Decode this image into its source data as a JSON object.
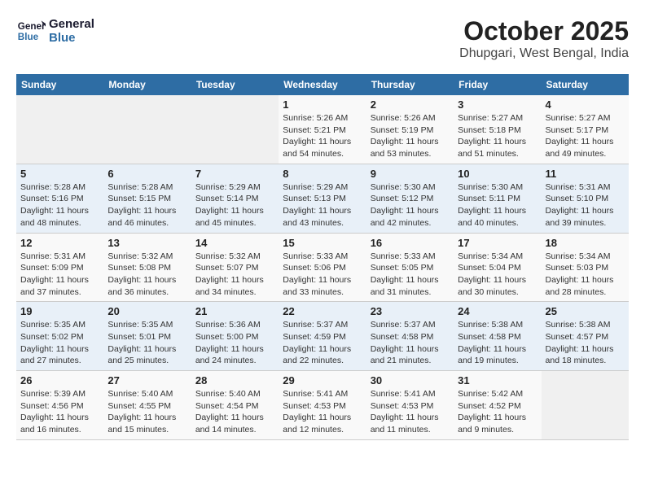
{
  "logo": {
    "line1": "General",
    "line2": "Blue"
  },
  "title": "October 2025",
  "subtitle": "Dhupgari, West Bengal, India",
  "headers": [
    "Sunday",
    "Monday",
    "Tuesday",
    "Wednesday",
    "Thursday",
    "Friday",
    "Saturday"
  ],
  "weeks": [
    [
      null,
      null,
      null,
      {
        "day": "1",
        "sunrise": "Sunrise: 5:26 AM",
        "sunset": "Sunset: 5:21 PM",
        "daylight": "Daylight: 11 hours and 54 minutes."
      },
      {
        "day": "2",
        "sunrise": "Sunrise: 5:26 AM",
        "sunset": "Sunset: 5:19 PM",
        "daylight": "Daylight: 11 hours and 53 minutes."
      },
      {
        "day": "3",
        "sunrise": "Sunrise: 5:27 AM",
        "sunset": "Sunset: 5:18 PM",
        "daylight": "Daylight: 11 hours and 51 minutes."
      },
      {
        "day": "4",
        "sunrise": "Sunrise: 5:27 AM",
        "sunset": "Sunset: 5:17 PM",
        "daylight": "Daylight: 11 hours and 49 minutes."
      }
    ],
    [
      {
        "day": "5",
        "sunrise": "Sunrise: 5:28 AM",
        "sunset": "Sunset: 5:16 PM",
        "daylight": "Daylight: 11 hours and 48 minutes."
      },
      {
        "day": "6",
        "sunrise": "Sunrise: 5:28 AM",
        "sunset": "Sunset: 5:15 PM",
        "daylight": "Daylight: 11 hours and 46 minutes."
      },
      {
        "day": "7",
        "sunrise": "Sunrise: 5:29 AM",
        "sunset": "Sunset: 5:14 PM",
        "daylight": "Daylight: 11 hours and 45 minutes."
      },
      {
        "day": "8",
        "sunrise": "Sunrise: 5:29 AM",
        "sunset": "Sunset: 5:13 PM",
        "daylight": "Daylight: 11 hours and 43 minutes."
      },
      {
        "day": "9",
        "sunrise": "Sunrise: 5:30 AM",
        "sunset": "Sunset: 5:12 PM",
        "daylight": "Daylight: 11 hours and 42 minutes."
      },
      {
        "day": "10",
        "sunrise": "Sunrise: 5:30 AM",
        "sunset": "Sunset: 5:11 PM",
        "daylight": "Daylight: 11 hours and 40 minutes."
      },
      {
        "day": "11",
        "sunrise": "Sunrise: 5:31 AM",
        "sunset": "Sunset: 5:10 PM",
        "daylight": "Daylight: 11 hours and 39 minutes."
      }
    ],
    [
      {
        "day": "12",
        "sunrise": "Sunrise: 5:31 AM",
        "sunset": "Sunset: 5:09 PM",
        "daylight": "Daylight: 11 hours and 37 minutes."
      },
      {
        "day": "13",
        "sunrise": "Sunrise: 5:32 AM",
        "sunset": "Sunset: 5:08 PM",
        "daylight": "Daylight: 11 hours and 36 minutes."
      },
      {
        "day": "14",
        "sunrise": "Sunrise: 5:32 AM",
        "sunset": "Sunset: 5:07 PM",
        "daylight": "Daylight: 11 hours and 34 minutes."
      },
      {
        "day": "15",
        "sunrise": "Sunrise: 5:33 AM",
        "sunset": "Sunset: 5:06 PM",
        "daylight": "Daylight: 11 hours and 33 minutes."
      },
      {
        "day": "16",
        "sunrise": "Sunrise: 5:33 AM",
        "sunset": "Sunset: 5:05 PM",
        "daylight": "Daylight: 11 hours and 31 minutes."
      },
      {
        "day": "17",
        "sunrise": "Sunrise: 5:34 AM",
        "sunset": "Sunset: 5:04 PM",
        "daylight": "Daylight: 11 hours and 30 minutes."
      },
      {
        "day": "18",
        "sunrise": "Sunrise: 5:34 AM",
        "sunset": "Sunset: 5:03 PM",
        "daylight": "Daylight: 11 hours and 28 minutes."
      }
    ],
    [
      {
        "day": "19",
        "sunrise": "Sunrise: 5:35 AM",
        "sunset": "Sunset: 5:02 PM",
        "daylight": "Daylight: 11 hours and 27 minutes."
      },
      {
        "day": "20",
        "sunrise": "Sunrise: 5:35 AM",
        "sunset": "Sunset: 5:01 PM",
        "daylight": "Daylight: 11 hours and 25 minutes."
      },
      {
        "day": "21",
        "sunrise": "Sunrise: 5:36 AM",
        "sunset": "Sunset: 5:00 PM",
        "daylight": "Daylight: 11 hours and 24 minutes."
      },
      {
        "day": "22",
        "sunrise": "Sunrise: 5:37 AM",
        "sunset": "Sunset: 4:59 PM",
        "daylight": "Daylight: 11 hours and 22 minutes."
      },
      {
        "day": "23",
        "sunrise": "Sunrise: 5:37 AM",
        "sunset": "Sunset: 4:58 PM",
        "daylight": "Daylight: 11 hours and 21 minutes."
      },
      {
        "day": "24",
        "sunrise": "Sunrise: 5:38 AM",
        "sunset": "Sunset: 4:58 PM",
        "daylight": "Daylight: 11 hours and 19 minutes."
      },
      {
        "day": "25",
        "sunrise": "Sunrise: 5:38 AM",
        "sunset": "Sunset: 4:57 PM",
        "daylight": "Daylight: 11 hours and 18 minutes."
      }
    ],
    [
      {
        "day": "26",
        "sunrise": "Sunrise: 5:39 AM",
        "sunset": "Sunset: 4:56 PM",
        "daylight": "Daylight: 11 hours and 16 minutes."
      },
      {
        "day": "27",
        "sunrise": "Sunrise: 5:40 AM",
        "sunset": "Sunset: 4:55 PM",
        "daylight": "Daylight: 11 hours and 15 minutes."
      },
      {
        "day": "28",
        "sunrise": "Sunrise: 5:40 AM",
        "sunset": "Sunset: 4:54 PM",
        "daylight": "Daylight: 11 hours and 14 minutes."
      },
      {
        "day": "29",
        "sunrise": "Sunrise: 5:41 AM",
        "sunset": "Sunset: 4:53 PM",
        "daylight": "Daylight: 11 hours and 12 minutes."
      },
      {
        "day": "30",
        "sunrise": "Sunrise: 5:41 AM",
        "sunset": "Sunset: 4:53 PM",
        "daylight": "Daylight: 11 hours and 11 minutes."
      },
      {
        "day": "31",
        "sunrise": "Sunrise: 5:42 AM",
        "sunset": "Sunset: 4:52 PM",
        "daylight": "Daylight: 11 hours and 9 minutes."
      },
      null
    ]
  ]
}
